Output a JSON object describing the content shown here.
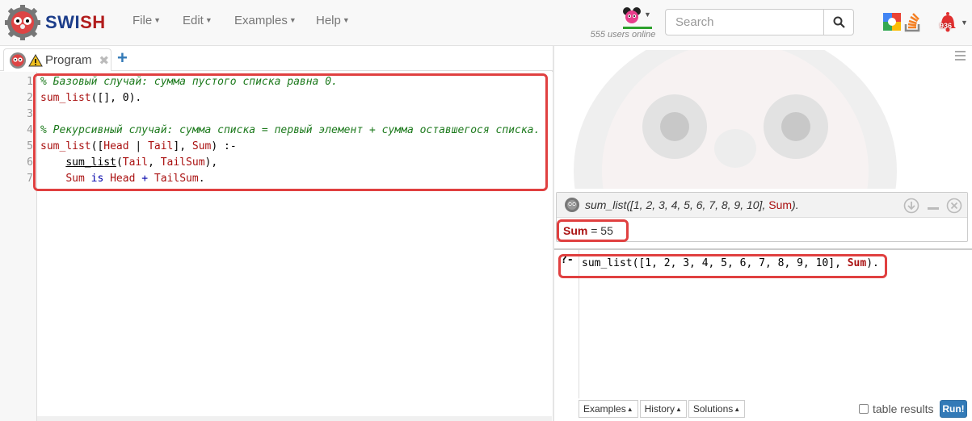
{
  "navbar": {
    "brand_part1": "SWI",
    "brand_part2": "SH",
    "menus": [
      "File",
      "Edit",
      "Examples",
      "Help"
    ],
    "users_online": "555 users online",
    "search_placeholder": "Search",
    "notification_count": "936"
  },
  "editor": {
    "tab_label": "Program",
    "tab_close": "✖",
    "add_tab": "+",
    "line_numbers": [
      "1",
      "2",
      "3",
      "4",
      "5",
      "6",
      "7"
    ],
    "lines": [
      "% Базовый случай: сумма пустого списка равна 0.",
      "sum_list([], 0).",
      "",
      "% Рекурсивный случай: сумма списка = первый элемент + сумма оставшегося списка.",
      "sum_list([Head | Tail], Sum) :-",
      "    sum_list(Tail, TailSum),",
      "    Sum is Head + TailSum."
    ]
  },
  "result": {
    "query_prefix": "sum_list([1, 2, 3, 4, 5, 6, 7, 8, 9, 10], ",
    "query_var": "Sum",
    "query_suffix": ").",
    "answer_var": "Sum",
    "answer_rest": " = 55"
  },
  "query": {
    "prompt": "?-",
    "text_prefix": "sum_list([1, 2, 3, 4, 5, 6, 7, 8, 9, 10], ",
    "text_var": "Sum",
    "text_suffix": ").",
    "buttons": [
      "Examples",
      "History",
      "Solutions"
    ],
    "table_results_label": "table results",
    "run_label": "Run!"
  },
  "colors": {
    "highlight_border": "#e04040",
    "run_button": "#337ab7",
    "comment": "#1d7a1d",
    "atom": "#a11"
  }
}
